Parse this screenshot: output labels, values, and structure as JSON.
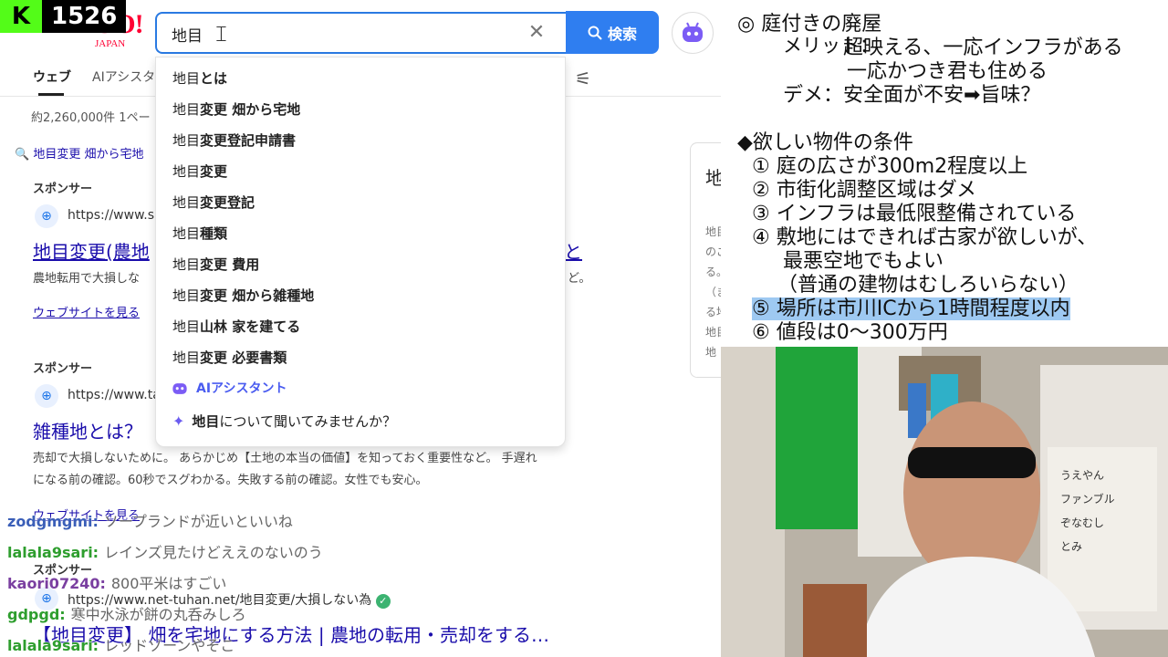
{
  "stream": {
    "viewer_count": "1526"
  },
  "browser": {
    "logo": {
      "main": "YAHOO!",
      "sub": "JAPAN"
    },
    "search": {
      "value": "地目",
      "search_button": "検索"
    },
    "tabs": [
      {
        "label": "ウェブ"
      },
      {
        "label": "AIアシスタ"
      }
    ],
    "result_count": "約2,260,000件  1ペー",
    "suggest_line": "地目変更 畑から宅地",
    "dropdown": {
      "items": [
        {
          "prefix": "地目",
          "rest": "とは"
        },
        {
          "prefix": "地目",
          "rest": "変更 畑から宅地"
        },
        {
          "prefix": "地目",
          "rest": "変更登記申請書"
        },
        {
          "prefix": "地目",
          "rest": "変更"
        },
        {
          "prefix": "地目",
          "rest": "変更登記"
        },
        {
          "prefix": "地目",
          "rest": " 種類"
        },
        {
          "prefix": "地目",
          "rest": "変更 費用"
        },
        {
          "prefix": "地目",
          "rest": "変更 畑から雑種地"
        },
        {
          "prefix": "地目",
          "rest": " 山林 家を建てる"
        },
        {
          "prefix": "地目",
          "rest": "変更 必要書類"
        }
      ],
      "ai_label": "AIアシスタント",
      "ask_bold": "地目",
      "ask_rest": "について聞いてみませんか？"
    },
    "ads": [
      {
        "sponsor": "スポンサー",
        "url": "https://www.sit",
        "title": "地目変更(農地",
        "title_tail": "と",
        "desc": "農地転用で大損しな",
        "desc_tail": "ど。",
        "link": "ウェブサイトを見る"
      },
      {
        "sponsor": "スポンサー",
        "url": "https://www.tai",
        "title": "雑種地とは？",
        "desc1": "売却で大損しないために。 あらかじめ【土地の本当の価値】を知っておく重要性など。 手遅れ",
        "desc2": "になる前の確認。60秒でスグわかる。失敗する前の確認。女性でも安心。",
        "link": "ウェブサイトを見る"
      },
      {
        "sponsor": "スポンサー",
        "url": "https://www.net-tuhan.net/地目変更/大損しない為",
        "title": "【地目変更】 畑を宅地にする方法 | 農地の転用・売却をする…"
      }
    ],
    "side_panel": {
      "title": "地",
      "lines": [
        "地目",
        "のご",
        "る。",
        "（ま",
        "る地",
        "地目",
        "地"
      ]
    }
  },
  "chat": [
    {
      "user": "zodgmgmi:",
      "msg": "ソープランドが近いといいね",
      "color": "#3b5fb8"
    },
    {
      "user": "lalala9sari:",
      "msg": "レインズ見たけどええのないのう",
      "color": "#2e9e2e"
    },
    {
      "user": "kaori07240:",
      "msg": "800平米はすごい",
      "color": "#7a3fa0"
    },
    {
      "user": "gdpgd:",
      "msg": "寒中水泳が餅の丸呑みしろ",
      "color": "#2e9e2e"
    },
    {
      "user": "lalala9sari:",
      "msg": "レッドゾーンやそこ",
      "color": "#2e9e2e"
    }
  ],
  "notes": {
    "section1_title": "◎ 庭付きの廃屋",
    "merit_label": "メリット：",
    "merit1": "超映える、一応インフラがある",
    "merit2": "一応かつき君も住める",
    "demerit": "デメ：安全面が不安➡旨味？",
    "section2_title": "◆欲しい物件の条件",
    "conditions": [
      "① 庭の広さが300m2程度以上",
      "② 市街化調整区域はダメ",
      "③ インフラは最低限整備されている",
      "④ 敷地にはできれば古家が欲しいが、",
      "最悪空地でもよい",
      "（普通の建物はむしろいらない）",
      "⑤ 場所は市川ICから1時間程度以内",
      "⑥ 値段は0〜300万円"
    ]
  },
  "camera": {
    "chips": [
      "うえやん",
      "ファンブル",
      "ぞなむし",
      "とみ"
    ]
  },
  "colors": {
    "accent": "#2f7ef0",
    "kick_green": "#53fc18",
    "yahoo_red": "#ff0033",
    "highlight": "#9ec9f2"
  }
}
